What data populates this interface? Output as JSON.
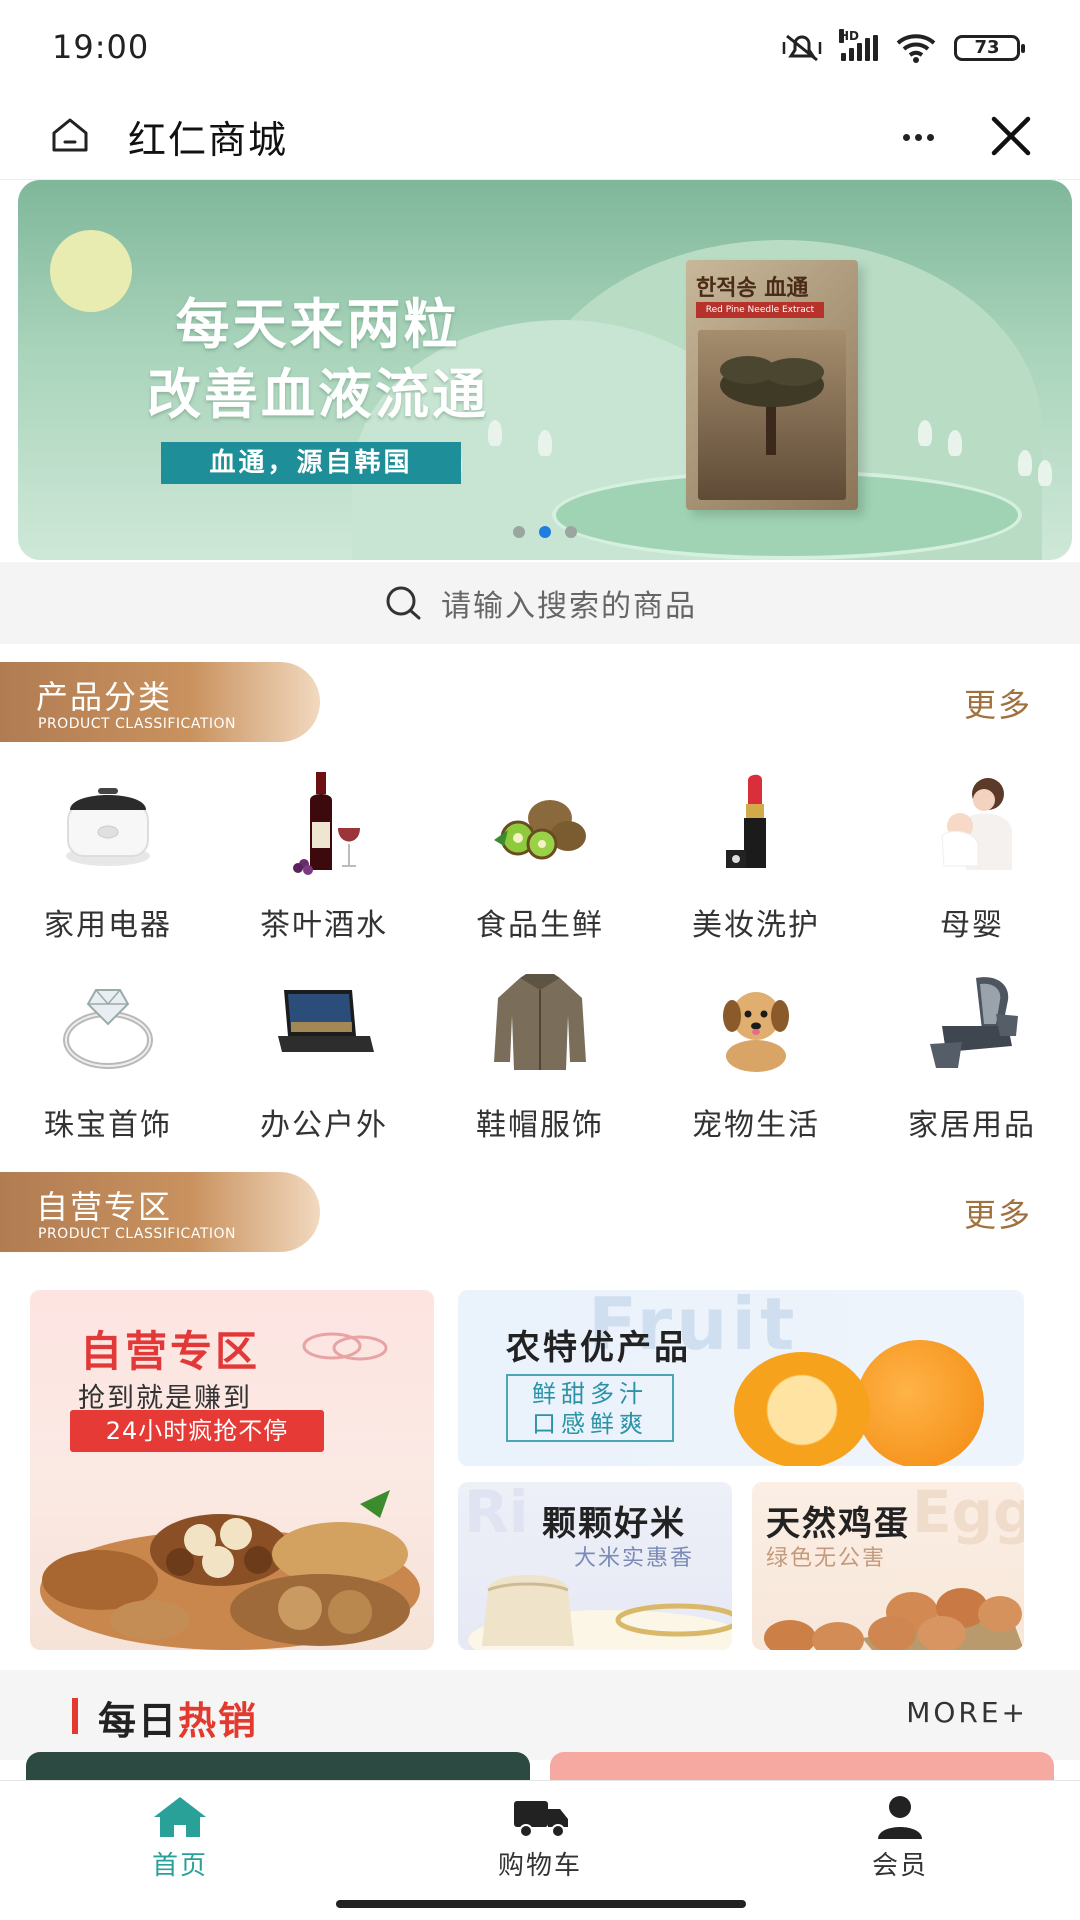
{
  "status_bar": {
    "time": "19:00",
    "network": "HD",
    "battery": "73"
  },
  "header": {
    "title": "红仁商城"
  },
  "banner": {
    "line1": "每天来两粒",
    "line2": "改善血液流通",
    "tag": "血通，源自韩国",
    "product_label": "한적송 血通",
    "product_sub": "Red Pine Needle Extract",
    "slides": 3,
    "active_slide": 2
  },
  "search": {
    "placeholder": "请输入搜索的商品"
  },
  "categories_section": {
    "title": "产品分类",
    "subtitle": "PRODUCT CLASSIFICATION",
    "more": "更多",
    "items": [
      {
        "label": "家用电器",
        "icon": "rice-cooker-icon"
      },
      {
        "label": "茶叶酒水",
        "icon": "wine-bottle-icon"
      },
      {
        "label": "食品生鲜",
        "icon": "kiwi-icon"
      },
      {
        "label": "美妆洗护",
        "icon": "lipstick-icon"
      },
      {
        "label": "母婴",
        "icon": "mother-baby-icon"
      },
      {
        "label": "珠宝首饰",
        "icon": "diamond-ring-icon"
      },
      {
        "label": "办公户外",
        "icon": "laptop-icon"
      },
      {
        "label": "鞋帽服饰",
        "icon": "jacket-icon"
      },
      {
        "label": "宠物生活",
        "icon": "puppy-icon"
      },
      {
        "label": "家居用品",
        "icon": "massage-chair-icon"
      }
    ]
  },
  "self_run_section": {
    "title": "自营专区",
    "subtitle": "PRODUCT CLASSIFICATION",
    "more": "更多",
    "left_card": {
      "title": "自营专区",
      "sub": "抢到就是赚到",
      "badge": "24小时疯抢不停"
    },
    "top_right_card": {
      "title": "农特优产品",
      "bg_word": "Fruit",
      "box_line1": "鲜甜多汁",
      "box_line2": "口感鲜爽"
    },
    "rice_card": {
      "title": "颗颗好米",
      "sub": "大米实惠香",
      "bg_word": "Ri"
    },
    "egg_card": {
      "title": "天然鸡蛋",
      "sub": "绿色无公害",
      "bg_word": "Egg"
    }
  },
  "daily_hot": {
    "title_a": "每日",
    "title_b": "热销",
    "more": "MORE+"
  },
  "bottom_nav": {
    "items": [
      {
        "label": "首页",
        "icon": "home-icon",
        "active": true
      },
      {
        "label": "购物车",
        "icon": "truck-icon",
        "active": false
      },
      {
        "label": "会员",
        "icon": "user-icon",
        "active": false
      }
    ]
  },
  "colors": {
    "accent": "#2aa198",
    "brand_brown": "#b17c52",
    "hot_red": "#e23a2e",
    "more_brown": "#a0703f"
  }
}
